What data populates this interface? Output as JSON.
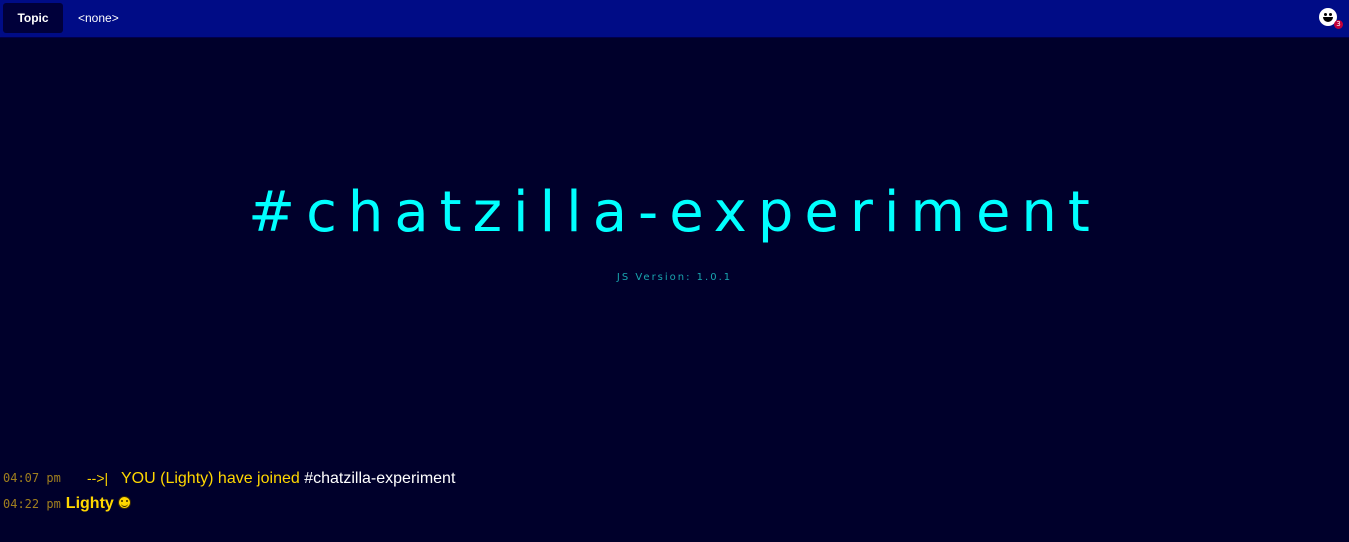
{
  "topbar": {
    "topic_label": "Topic",
    "topic_value": "<none>",
    "user_count": "3"
  },
  "header": {
    "channel_name": "#chatzilla-experiment",
    "version": "JS Version: 1.0.1"
  },
  "messages": [
    {
      "time": "04:07 pm",
      "arrow": "-->|",
      "text": "YOU (Lighty) have joined",
      "channel": " #chatzilla-experiment"
    },
    {
      "time": "04:22 pm",
      "nick": "Lighty",
      "emoji": "smiley-emoji"
    }
  ],
  "colors": {
    "topbar_bg": "#000c86",
    "background": "#00002b",
    "channel_title": "#00ffff",
    "nick": "#ffd700",
    "timestamp": "#a07f1e"
  }
}
